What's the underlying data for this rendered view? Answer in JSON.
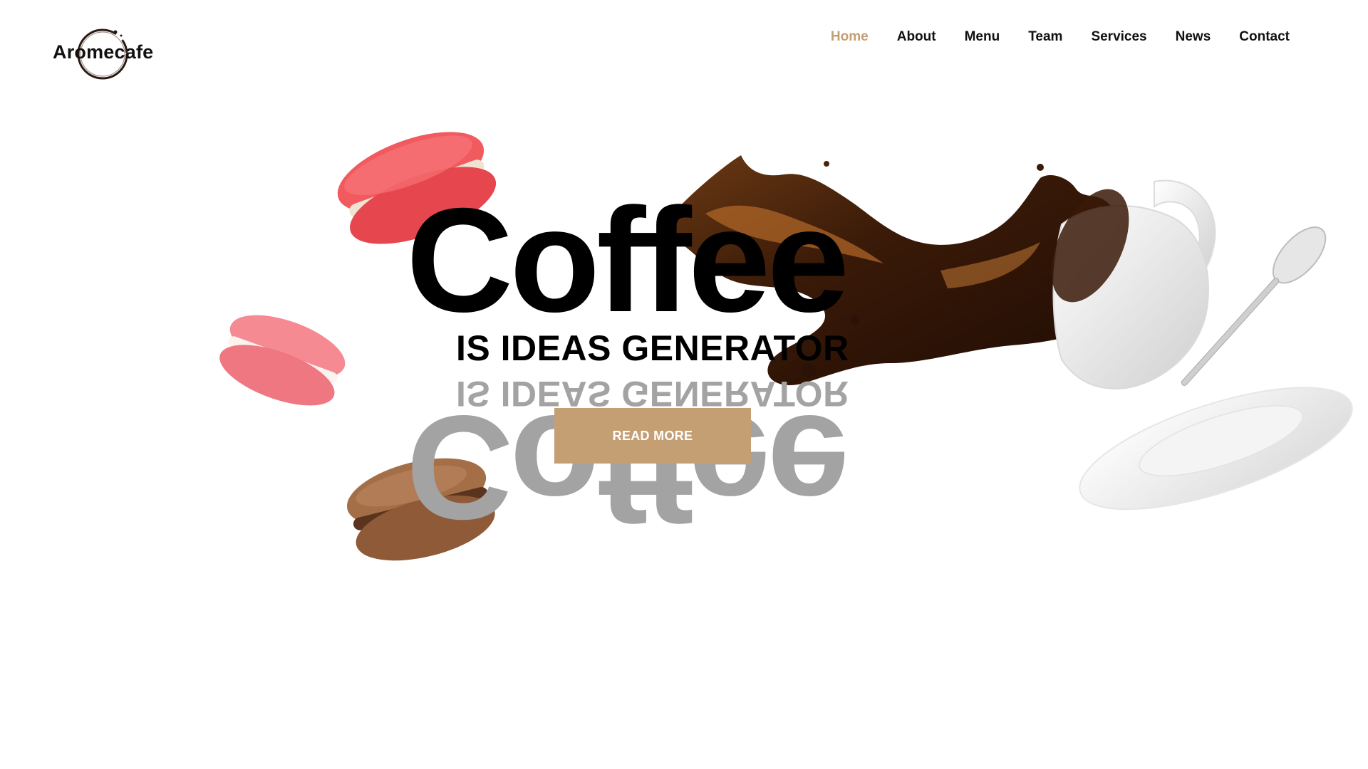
{
  "site": {
    "logo_text": "Aromecafe"
  },
  "nav": {
    "items": [
      {
        "label": "Home",
        "active": true
      },
      {
        "label": "About",
        "active": false
      },
      {
        "label": "Menu",
        "active": false
      },
      {
        "label": "Team",
        "active": false
      },
      {
        "label": "Services",
        "active": false
      },
      {
        "label": "News",
        "active": false
      },
      {
        "label": "Contact",
        "active": false
      }
    ]
  },
  "hero": {
    "title": "Coffee",
    "subtitle": "IS IDEAS GENERATOR",
    "button_label": "READ MORE"
  },
  "colors": {
    "accent": "#c49f74",
    "text": "#111111",
    "reflection": "#a3a3a3",
    "background": "#ffffff"
  },
  "images": {
    "macaron_red": "macaron-red-image",
    "macaron_pink": "macaron-pink-image",
    "macaron_chocolate": "macaron-chocolate-image",
    "coffee_splash": "coffee-splash-image",
    "cup": "coffee-cup-image",
    "spoon": "spoon-image",
    "saucer": "saucer-image"
  }
}
